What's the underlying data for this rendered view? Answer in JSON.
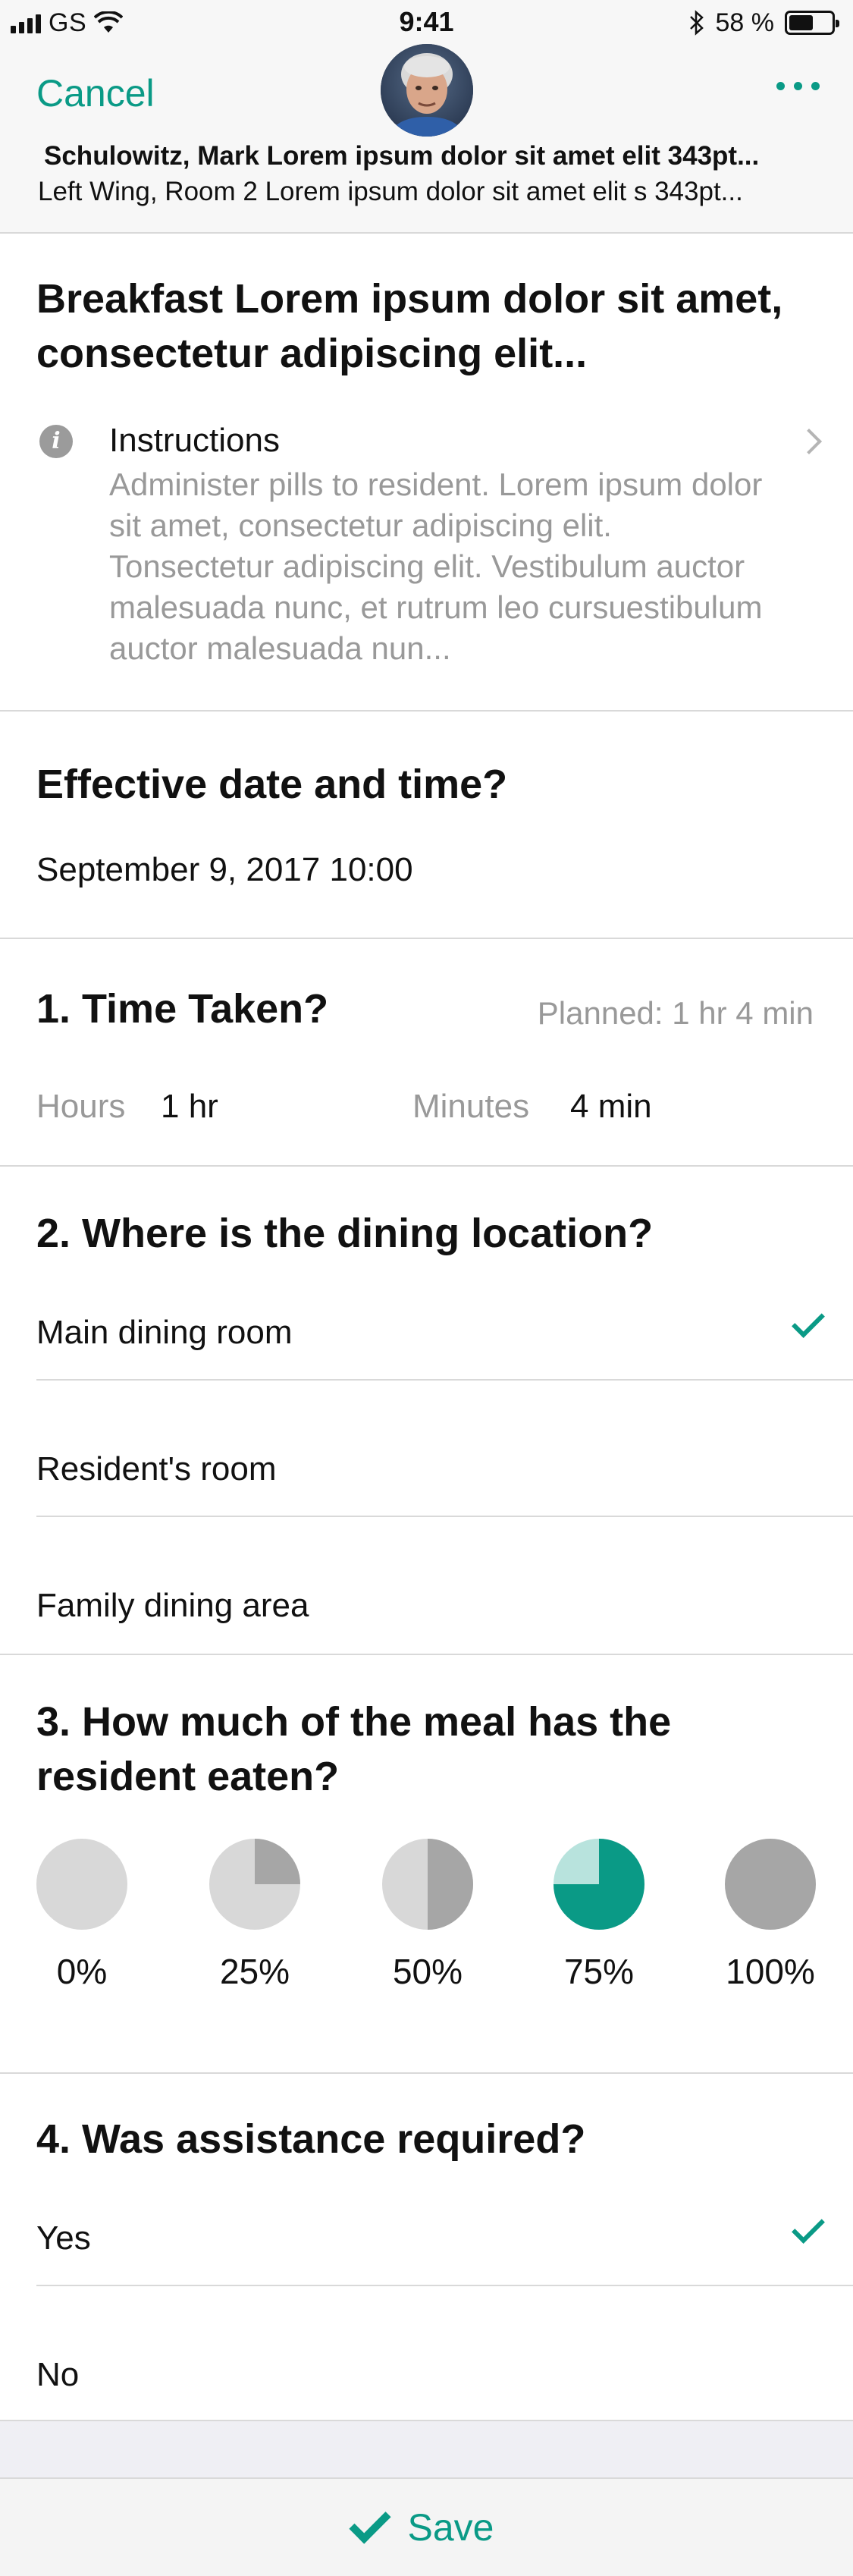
{
  "status": {
    "carrier": "GS",
    "time": "9:41",
    "battery": "58 %",
    "battery_level": 0.58
  },
  "header": {
    "cancel": "Cancel",
    "patient_name": "Schulowitz, Mark Lorem ipsum dolor sit amet elit 343pt...",
    "patient_location": "Left Wing, Room 2 Lorem ipsum dolor sit amet elit s 343pt..."
  },
  "task": {
    "title": "Breakfast Lorem ipsum dolor sit amet, consectetur adipiscing elit...",
    "instructions_label": "Instructions",
    "instructions_text": "Administer pills to resident. Lorem ipsum dolor sit amet, consectetur adipiscing elit. Tonsectetur adipiscing elit. Vestibulum auctor malesuada nunc, et rutrum leo cursuestibulum auctor malesuada nun..."
  },
  "effective": {
    "title": "Effective date and time?",
    "value": "September 9, 2017 10:00"
  },
  "time_taken": {
    "title": "1. Time Taken?",
    "planned": "Planned: 1 hr 4 min",
    "hours_label": "Hours",
    "hours_value": "1 hr",
    "minutes_label": "Minutes",
    "minutes_value": "4 min"
  },
  "dining": {
    "title": "2. Where is the dining location?",
    "options": [
      {
        "label": "Main dining room",
        "selected": true
      },
      {
        "label": "Resident's room",
        "selected": false
      },
      {
        "label": "Family dining area",
        "selected": false
      }
    ]
  },
  "meal": {
    "title": "3. How much of the meal has the resident eaten?",
    "options": [
      {
        "label": "0%",
        "fraction": 0,
        "selected": false
      },
      {
        "label": "25%",
        "fraction": 0.25,
        "selected": false
      },
      {
        "label": "50%",
        "fraction": 0.5,
        "selected": false
      },
      {
        "label": "75%",
        "fraction": 0.75,
        "selected": true
      },
      {
        "label": "100%",
        "fraction": 1,
        "selected": false
      }
    ]
  },
  "assistance": {
    "title": "4. Was assistance required?",
    "options": [
      {
        "label": "Yes",
        "selected": true
      },
      {
        "label": "No",
        "selected": false
      }
    ]
  },
  "footer": {
    "save": "Save"
  },
  "colors": {
    "accent": "#0a9a86",
    "accent_light": "#b8e3dd",
    "pie_filled": "#a6a6a6",
    "pie_empty": "#d8d8d8"
  }
}
